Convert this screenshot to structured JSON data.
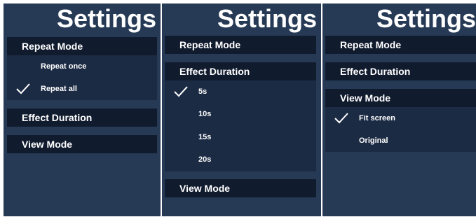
{
  "panels": [
    {
      "title": "Settings",
      "sections": {
        "repeat_mode": "Repeat Mode",
        "effect_duration": "Effect Duration",
        "view_mode": "View Mode"
      },
      "options": [
        "Repeat once",
        "Repeat all"
      ],
      "selected": "Repeat all"
    },
    {
      "title": "Settings",
      "sections": {
        "repeat_mode": "Repeat Mode",
        "effect_duration": "Effect Duration",
        "view_mode": "View Mode"
      },
      "options": [
        "5s",
        "10s",
        "15s",
        "20s"
      ],
      "selected": "5s"
    },
    {
      "title": "Settings",
      "sections": {
        "repeat_mode": "Repeat Mode",
        "effect_duration": "Effect Duration",
        "view_mode": "View Mode"
      },
      "options": [
        "Fit screen",
        "Original"
      ],
      "selected": "Fit screen"
    }
  ],
  "icons": {
    "check": "checkmark-icon"
  },
  "colors": {
    "background": "#263a56",
    "header": "#101b2e",
    "options": "#1c2b44",
    "text": "#ffffff"
  }
}
